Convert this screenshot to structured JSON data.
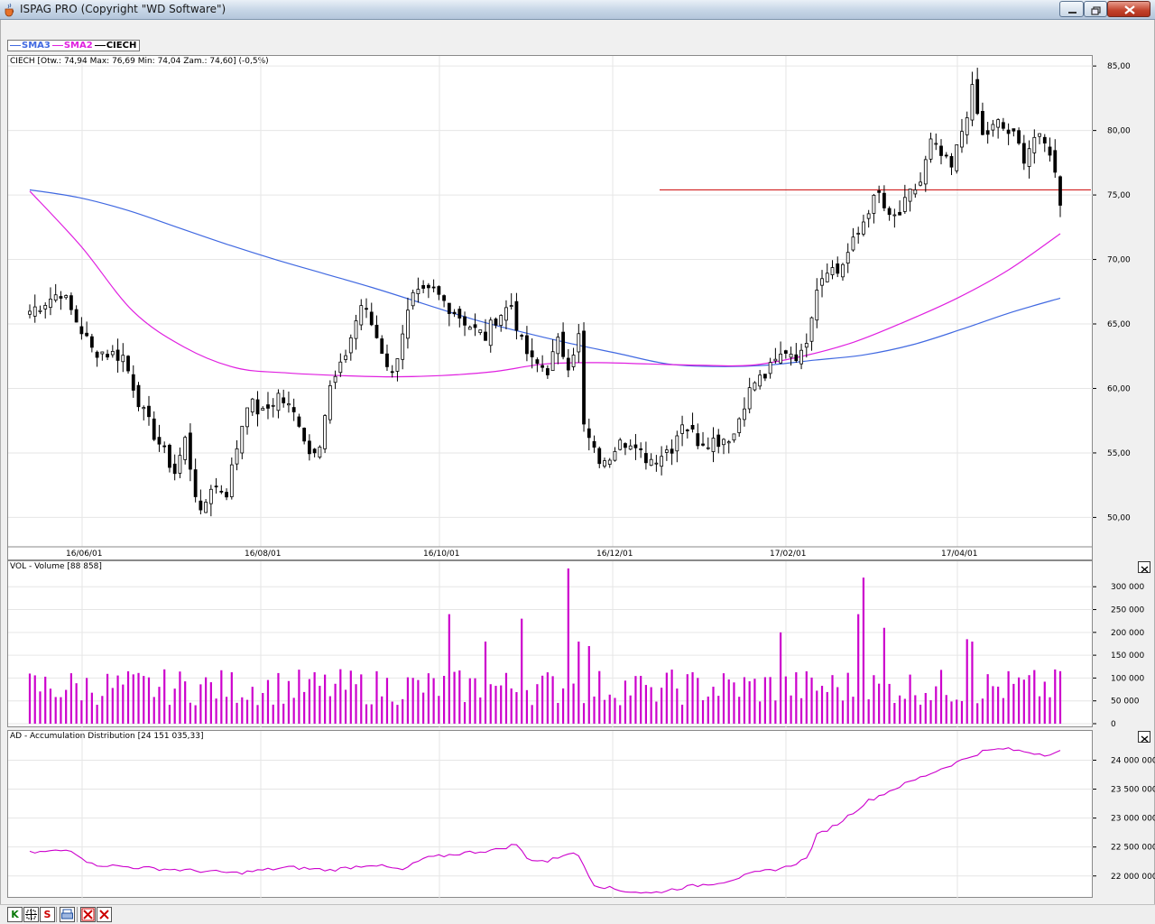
{
  "window": {
    "title": "ISPAG PRO (Copyright \"WD Software\")",
    "icon": "java-cup-icon"
  },
  "legend": [
    {
      "label": "SMA3",
      "color": "#4169e1"
    },
    {
      "label": "SMA2",
      "color": "#e020e0"
    },
    {
      "label": "CIECH",
      "color": "#000000"
    }
  ],
  "price_panel": {
    "label": "CIECH [Otw.: 74,94  Max: 76,69  Min: 74,04  Zam.: 74,60] (-0,5%)",
    "y_ticks": [
      "85,00",
      "80,00",
      "75,00",
      "70,00",
      "65,00",
      "60,00",
      "55,00",
      "50,00"
    ],
    "x_ticks": [
      "16/06/01",
      "16/08/01",
      "16/10/01",
      "16/12/01",
      "17/02/01",
      "17/04/01"
    ]
  },
  "volume_panel": {
    "label": "VOL - Volume [88 858]",
    "y_ticks": [
      "300 000",
      "250 000",
      "200 000",
      "150 000",
      "100 000",
      "50 000",
      "0"
    ]
  },
  "ad_panel": {
    "label": "AD - Accumulation Distribution [24 151 035,33]",
    "y_ticks": [
      "24 000 000",
      "23 500 000",
      "23 000 000",
      "22 500 000",
      "22 000 000"
    ]
  },
  "colors": {
    "sma3": "#4169e1",
    "sma2": "#e020e0",
    "volume_bar": "#cc00cc",
    "resistance_line": "#cc0000",
    "candle": "#000000",
    "ad_line": "#cc00cc"
  },
  "toolbar": [
    {
      "label": "K",
      "icon": "k-icon",
      "color": "#0a7a0a"
    },
    {
      "label": "",
      "icon": "crosshair-icon",
      "color": "#000000"
    },
    {
      "label": "S",
      "icon": "s-icon",
      "color": "#cc0000"
    },
    {
      "label": "",
      "icon": "print-icon",
      "color": "#1f4fa0"
    },
    {
      "label": "",
      "icon": "delete-all-icon",
      "color": "#cc0000"
    },
    {
      "label": "",
      "icon": "delete-icon",
      "color": "#cc0000"
    }
  ],
  "chart_data": {
    "type": "candlestick",
    "title": "CIECH",
    "resistance_level": 75.4,
    "ylim": [
      48.0,
      85.5
    ],
    "series": [
      {
        "name": "SMA3",
        "values": [
          75.4,
          74.8,
          73.8,
          72.5,
          71.2,
          70.0,
          68.9,
          67.8,
          66.6,
          65.4,
          64.4,
          63.5,
          62.7,
          61.9,
          61.7,
          61.8,
          62.2,
          62.6,
          63.4,
          64.6,
          65.9,
          67.0
        ]
      },
      {
        "name": "SMA2",
        "values": [
          75.3,
          71.0,
          66.0,
          63.2,
          61.6,
          61.2,
          61.0,
          60.9,
          61.0,
          61.3,
          61.9,
          62.0,
          61.9,
          61.8,
          61.8,
          62.5,
          63.6,
          65.2,
          67.0,
          69.2,
          72.0
        ]
      }
    ]
  }
}
